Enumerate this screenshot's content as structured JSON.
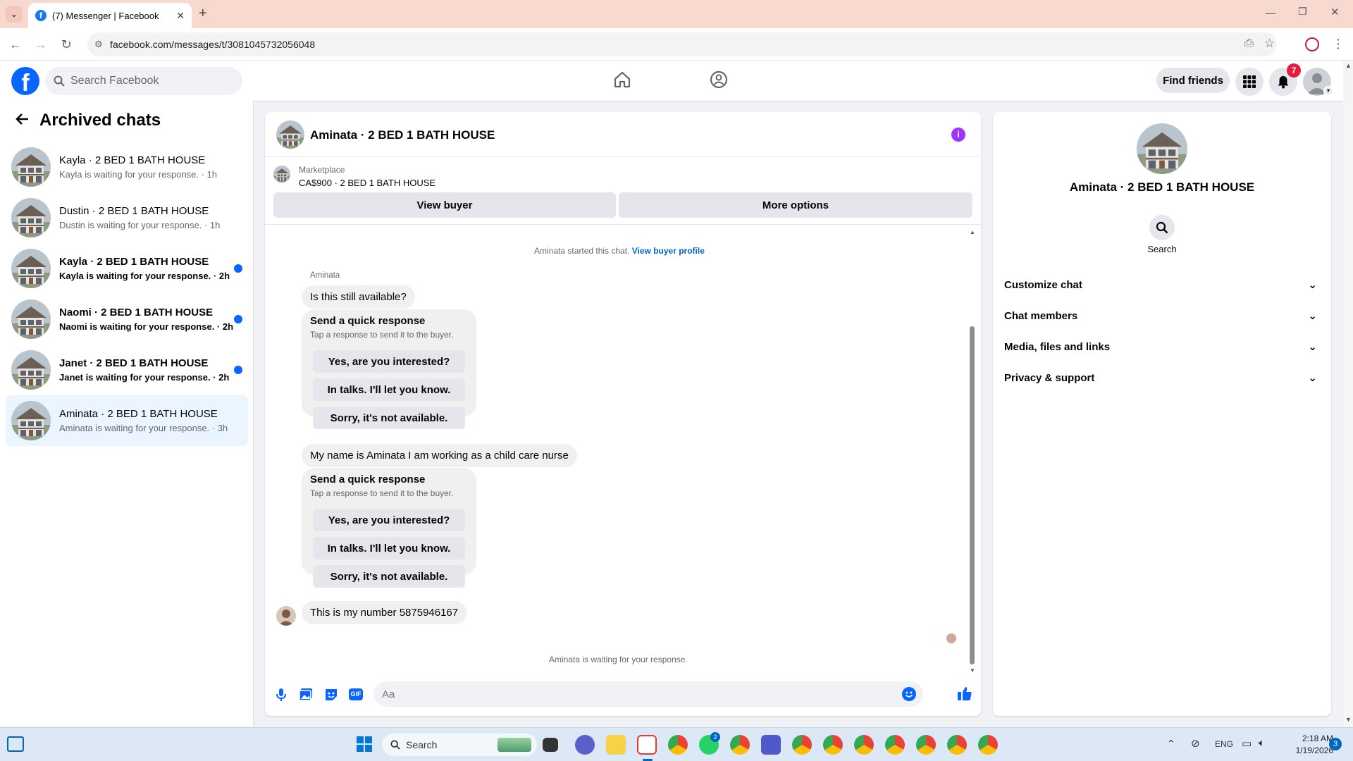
{
  "browser": {
    "tab_title": "(7) Messenger | Facebook",
    "url": "facebook.com/messages/t/3081045732056048",
    "new_tab_label": "+"
  },
  "fb_header": {
    "search_placeholder": "Search Facebook",
    "find_friends_label": "Find friends",
    "notification_count": "7"
  },
  "left": {
    "title": "Archived chats",
    "chats": [
      {
        "name": "Kayla · 2 BED 1 BATH HOUSE",
        "preview": "Kayla is waiting for your response. · 1h",
        "unread": false,
        "active": false
      },
      {
        "name": "Dustin · 2 BED 1 BATH HOUSE",
        "preview": "Dustin is waiting for your response. · 1h",
        "unread": false,
        "active": false
      },
      {
        "name": "Kayla · 2 BED 1 BATH HOUSE",
        "preview": "Kayla is waiting for your response. · 2h",
        "unread": true,
        "active": false
      },
      {
        "name": "Naomi · 2 BED 1 BATH HOUSE",
        "preview": "Naomi is waiting for your response. · 2h",
        "unread": true,
        "active": false
      },
      {
        "name": "Janet · 2 BED 1 BATH HOUSE",
        "preview": "Janet is waiting for your response. · 2h",
        "unread": true,
        "active": false
      },
      {
        "name": "Aminata · 2 BED 1 BATH HOUSE",
        "preview": "Aminata is waiting for your response. · 3h",
        "unread": false,
        "active": true
      }
    ]
  },
  "conversation": {
    "title": "Aminata · 2 BED 1 BATH HOUSE",
    "marketplace_label": "Marketplace",
    "listing": "CA$900 · 2 BED 1 BATH HOUSE",
    "view_buyer_label": "View buyer",
    "more_options_label": "More options",
    "started_text": "Aminata started this chat.",
    "view_buyer_profile_label": "View buyer profile",
    "sender_name": "Aminata",
    "msg1": "Is this still available?",
    "quick_response_title": "Send a quick response",
    "quick_response_hint": "Tap a response to send it to the buyer.",
    "quick_responses": [
      "Yes, are you interested?",
      "In talks. I'll let you know.",
      "Sorry, it's not available."
    ],
    "msg2": "My name is Aminata I am working as a child care nurse",
    "msg3": "This is my number 5875946167",
    "waiting_text": "Aminata is waiting for your response.",
    "composer_placeholder": "Aa"
  },
  "right_panel": {
    "name": "Aminata · 2 BED 1 BATH HOUSE",
    "search_label": "Search",
    "sections": [
      "Customize chat",
      "Chat members",
      "Media, files and links",
      "Privacy & support"
    ]
  },
  "taskbar": {
    "search_placeholder": "Search",
    "language": "ENG",
    "time": "2:18 AM",
    "date": "1/19/2026",
    "whatsapp_badge": "2",
    "notif_badge": "3"
  },
  "colors": {
    "accent": "#0866ff",
    "tab_strip": "#f8d9cf",
    "active_chat": "#ebf5ff",
    "bubble": "#f0f0f0",
    "info_icon": "#a033ff"
  }
}
